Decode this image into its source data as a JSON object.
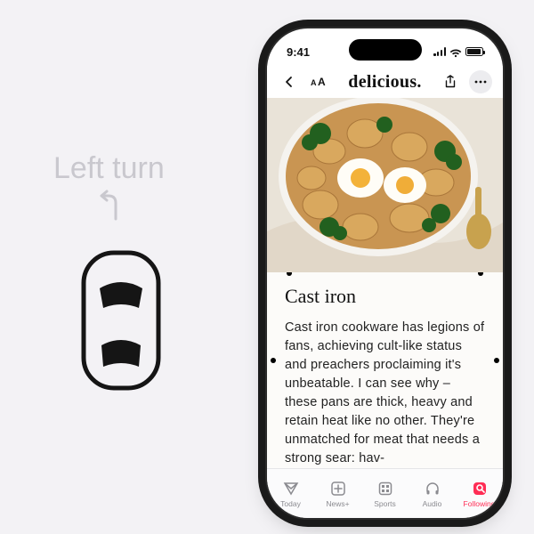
{
  "decor": {
    "left_turn_label": "Left turn"
  },
  "status": {
    "time": "9:41"
  },
  "header": {
    "brand": "delicious."
  },
  "article": {
    "heading": "Cast iron",
    "body": "Cast iron cookware has legions of fans, achieving cult-like status and preachers proclaiming it's unbeatable. I can see why – these pans are thick, heavy and retain heat like no other. They're unmatched for meat that needs a strong sear: hav-"
  },
  "tabs": {
    "today": "Today",
    "newsplus": "News+",
    "sports": "Sports",
    "audio": "Audio",
    "following": "Following",
    "active": "following"
  }
}
